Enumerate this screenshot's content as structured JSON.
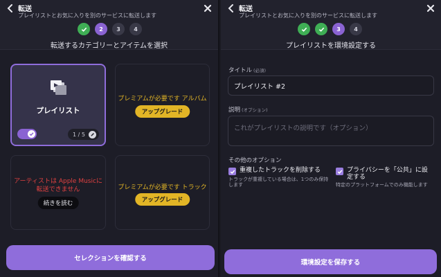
{
  "colors": {
    "accent": "#8f6ddb",
    "done_step": "#3fae55",
    "premium": "#e2b526",
    "error": "#e04141",
    "background": "#1d1d27"
  },
  "left": {
    "header": {
      "title": "転送",
      "subtitle": "プレイリストとお気に入りを別のサービスに転送します",
      "back_icon": "chevron-left-icon",
      "close_icon": "close-icon"
    },
    "steps": [
      {
        "label": "",
        "state": "done"
      },
      {
        "label": "2",
        "state": "active"
      },
      {
        "label": "3",
        "state": "todo"
      },
      {
        "label": "4",
        "state": "todo"
      }
    ],
    "step_title": "転送するカテゴリーとアイテムを選択",
    "cards": {
      "playlist": {
        "label": "プレイリスト",
        "counter": "1 / 5",
        "toggle_on": true,
        "icon": "playlist-icon"
      },
      "album": {
        "premium_text": "プレミアムが必要です アルバム",
        "button": "アップグレード"
      },
      "artist": {
        "error_line1": "アーティストは Apple Musicに",
        "error_line2": "転送できません",
        "button": "続きを読む"
      },
      "track": {
        "premium_text": "プレミアムが必要です トラック",
        "button": "アップグレード"
      }
    },
    "confirm_button": "セレクションを確認する"
  },
  "right": {
    "header": {
      "title": "転送",
      "subtitle": "プレイリストとお気に入りを別のサービスに転送します",
      "back_icon": "chevron-left-icon",
      "close_icon": "close-icon"
    },
    "steps": [
      {
        "label": "",
        "state": "done"
      },
      {
        "label": "",
        "state": "done"
      },
      {
        "label": "3",
        "state": "active"
      },
      {
        "label": "4",
        "state": "todo"
      }
    ],
    "step_title": "プレイリストを環境設定する",
    "title_label": "タイトル",
    "title_required": "(必須)",
    "title_value": "プレイリスト #2",
    "desc_label": "説明",
    "desc_optional": "(オプション)",
    "desc_placeholder": "これがプレイリストの説明です（オプション）",
    "other_options": "その他のオプション",
    "options": {
      "remove_duplicates": {
        "label": "重複したトラックを削除する",
        "desc": "トラックが重複している場合は、1つのみ保持します",
        "checked": true
      },
      "public": {
        "label": "プライバシーを「公共」に設定する",
        "desc": "特定のプラットフォームでのみ機能します",
        "checked": true
      }
    },
    "save_button": "環境設定を保存する"
  }
}
